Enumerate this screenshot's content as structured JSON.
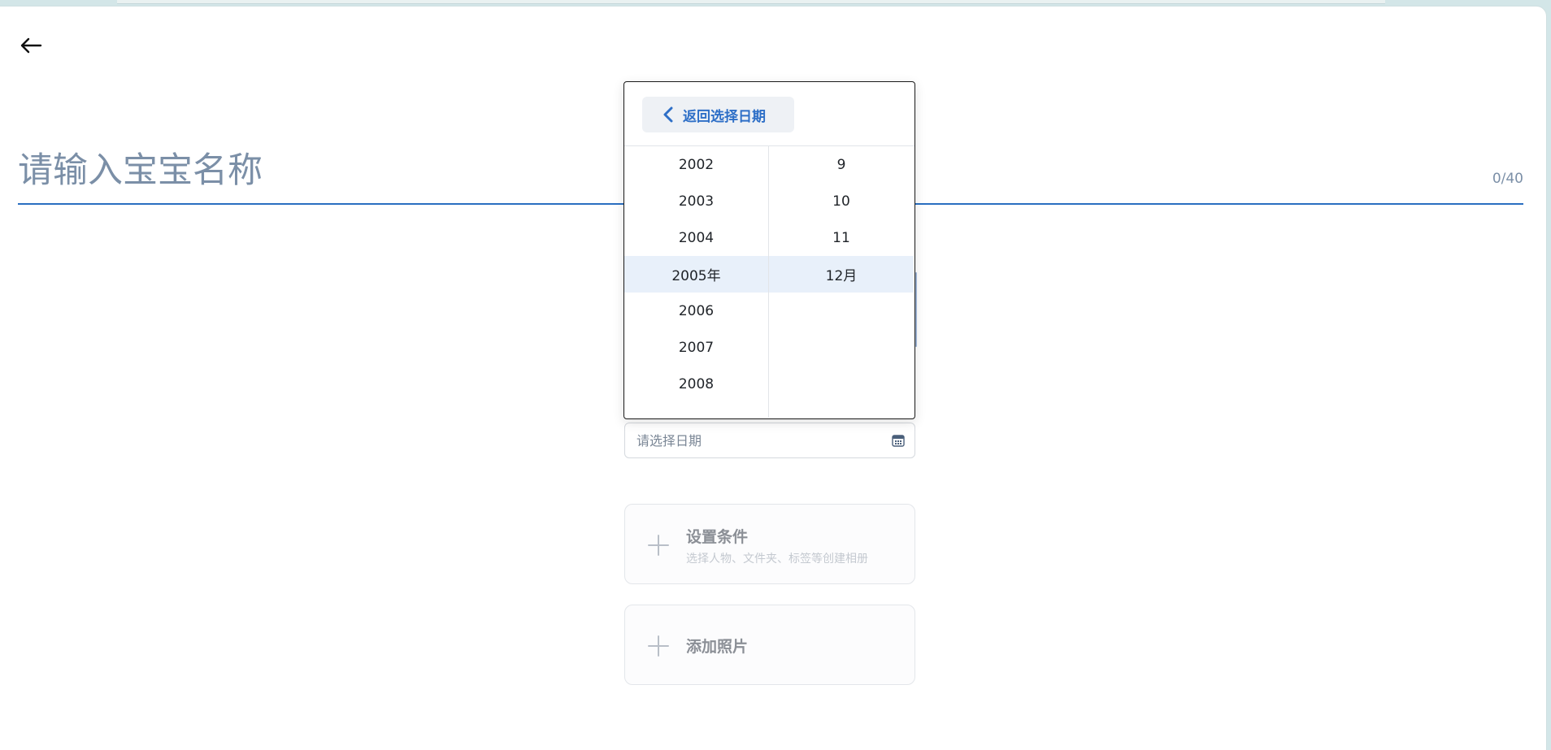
{
  "header": {
    "back_icon": "arrow-left-icon"
  },
  "name_input": {
    "placeholder": "请输入宝宝名称",
    "value": "",
    "char_count": "0/40"
  },
  "date_picker": {
    "back_label": "返回选择日期",
    "back_icon": "chevron-left-icon",
    "years": [
      "2002",
      "2003",
      "2004",
      "2005年",
      "2006",
      "2007",
      "2008"
    ],
    "selected_year": "2005年",
    "months": [
      "9",
      "10",
      "11",
      "12月"
    ],
    "selected_month": "12月"
  },
  "date_field": {
    "placeholder": "请选择日期",
    "value": "",
    "icon": "calendar-icon"
  },
  "conditions_card": {
    "icon": "plus-icon",
    "title": "设置条件",
    "subtitle": "选择人物、文件夹、标签等创建相册"
  },
  "photos_card": {
    "icon": "plus-icon",
    "title": "添加照片"
  },
  "colors": {
    "accent": "#2e6fc7",
    "underline": "#2a6fc1",
    "placeholder": "#7b8fa7",
    "selected_row": "#e8f0fa",
    "background": "#d3e6e8"
  }
}
